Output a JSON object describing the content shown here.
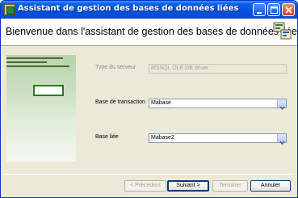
{
  "window": {
    "title": "Assistant de gestion des bases de données liées"
  },
  "header": {
    "welcome": "Bienvenue dans l'assistant de gestion des bases de données liées"
  },
  "form": {
    "server_type": {
      "label": "Type du serveur",
      "value": "MSSQL OLE DB driver",
      "disabled": true
    },
    "transaction_base": {
      "label": "Base de transaction",
      "value": "Mabase"
    },
    "linked_base": {
      "label": "Base liée",
      "value": "Mabase2"
    }
  },
  "buttons": {
    "previous": "< Précédent",
    "next": "Suivant >",
    "finish": "Terminer",
    "cancel": "Annuler"
  },
  "colors": {
    "titlebar": "#0a5fe8",
    "panel": "#c8ddbe",
    "accent_green": "#2d7a1e"
  }
}
